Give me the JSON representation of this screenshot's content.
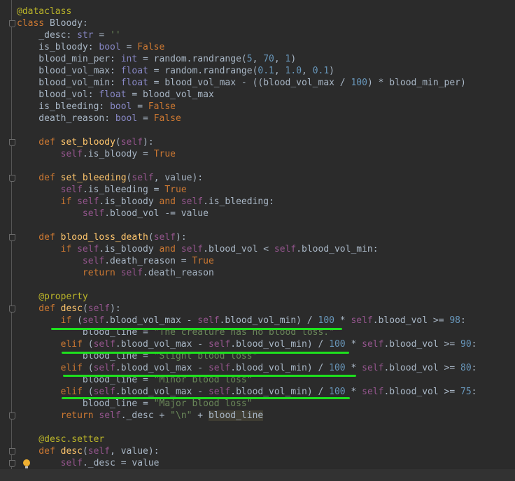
{
  "editor": {
    "lines": [
      [
        [
          "@dataclass",
          "dec"
        ]
      ],
      [
        [
          "class ",
          "kw"
        ],
        [
          "Bloody:",
          "plain"
        ]
      ],
      [
        [
          "    _desc: ",
          "plain"
        ],
        [
          "str",
          "bi"
        ],
        [
          " = ",
          "plain"
        ],
        [
          "''",
          "str"
        ]
      ],
      [
        [
          "    is_bloody: ",
          "plain"
        ],
        [
          "bool",
          "bi"
        ],
        [
          " = ",
          "plain"
        ],
        [
          "False",
          "kw"
        ]
      ],
      [
        [
          "    blood_min_per: ",
          "plain"
        ],
        [
          "int",
          "bi"
        ],
        [
          " = random.randrange(",
          "plain"
        ],
        [
          "5",
          "num"
        ],
        [
          ", ",
          "plain"
        ],
        [
          "70",
          "num"
        ],
        [
          ", ",
          "plain"
        ],
        [
          "1",
          "num"
        ],
        [
          ")",
          "plain"
        ]
      ],
      [
        [
          "    blood_vol_max: ",
          "plain"
        ],
        [
          "float",
          "bi"
        ],
        [
          " = random.randrange(",
          "plain"
        ],
        [
          "0.1",
          "num"
        ],
        [
          ", ",
          "plain"
        ],
        [
          "1.0",
          "num"
        ],
        [
          ", ",
          "plain"
        ],
        [
          "0.1",
          "num"
        ],
        [
          ")",
          "plain"
        ]
      ],
      [
        [
          "    blood_vol_min: ",
          "plain"
        ],
        [
          "float",
          "bi"
        ],
        [
          " = blood_vol_max - ((blood_vol_max / ",
          "plain"
        ],
        [
          "100",
          "num"
        ],
        [
          ") * blood_min_per)",
          "plain"
        ]
      ],
      [
        [
          "    blood_vol: ",
          "plain"
        ],
        [
          "float",
          "bi"
        ],
        [
          " = blood_vol_max",
          "plain"
        ]
      ],
      [
        [
          "    is_bleeding: ",
          "plain"
        ],
        [
          "bool",
          "bi"
        ],
        [
          " = ",
          "plain"
        ],
        [
          "False",
          "kw"
        ]
      ],
      [
        [
          "    death_reason: ",
          "plain"
        ],
        [
          "bool",
          "bi"
        ],
        [
          " = ",
          "plain"
        ],
        [
          "False",
          "kw"
        ]
      ],
      [],
      [
        [
          "    def ",
          "kw"
        ],
        [
          "set_bloody",
          "fn"
        ],
        [
          "(",
          "plain"
        ],
        [
          "self",
          "self"
        ],
        [
          "):",
          "plain"
        ]
      ],
      [
        [
          "        ",
          "plain"
        ],
        [
          "self",
          "self"
        ],
        [
          ".is_bloody = ",
          "plain"
        ],
        [
          "True",
          "kw"
        ]
      ],
      [],
      [
        [
          "    def ",
          "kw"
        ],
        [
          "set_bleeding",
          "fn"
        ],
        [
          "(",
          "plain"
        ],
        [
          "self",
          "self"
        ],
        [
          ", value):",
          "plain"
        ]
      ],
      [
        [
          "        ",
          "plain"
        ],
        [
          "self",
          "self"
        ],
        [
          ".is_bleeding = ",
          "plain"
        ],
        [
          "True",
          "kw"
        ]
      ],
      [
        [
          "        if ",
          "kw"
        ],
        [
          "self",
          "self"
        ],
        [
          ".is_bloody ",
          "plain"
        ],
        [
          "and ",
          "kw"
        ],
        [
          "self",
          "self"
        ],
        [
          ".is_bleeding:",
          "plain"
        ]
      ],
      [
        [
          "            ",
          "plain"
        ],
        [
          "self",
          "self"
        ],
        [
          ".blood_vol -= value",
          "plain"
        ]
      ],
      [],
      [
        [
          "    def ",
          "kw"
        ],
        [
          "blood_loss_death",
          "fn"
        ],
        [
          "(",
          "plain"
        ],
        [
          "self",
          "self"
        ],
        [
          "):",
          "plain"
        ]
      ],
      [
        [
          "        if ",
          "kw"
        ],
        [
          "self",
          "self"
        ],
        [
          ".is_bloody ",
          "plain"
        ],
        [
          "and ",
          "kw"
        ],
        [
          "self",
          "self"
        ],
        [
          ".blood_vol < ",
          "plain"
        ],
        [
          "self",
          "self"
        ],
        [
          ".blood_vol_min:",
          "plain"
        ]
      ],
      [
        [
          "            ",
          "plain"
        ],
        [
          "self",
          "self"
        ],
        [
          ".death_reason = ",
          "plain"
        ],
        [
          "True",
          "kw"
        ]
      ],
      [
        [
          "            return ",
          "kw"
        ],
        [
          "self",
          "self"
        ],
        [
          ".death_reason",
          "plain"
        ]
      ],
      [],
      [
        [
          "    @property",
          "dec"
        ]
      ],
      [
        [
          "    def ",
          "kw"
        ],
        [
          "desc",
          "fn"
        ],
        [
          "(",
          "plain"
        ],
        [
          "self",
          "self"
        ],
        [
          "):",
          "plain"
        ]
      ],
      [
        [
          "        if ",
          "kw"
        ],
        [
          "(",
          "plain"
        ],
        [
          "self",
          "self"
        ],
        [
          ".blood_vol_max - ",
          "plain"
        ],
        [
          "self",
          "self"
        ],
        [
          ".blood_vol_min) / ",
          "plain"
        ],
        [
          "100",
          "num"
        ],
        [
          " * ",
          "plain"
        ],
        [
          "self",
          "self"
        ],
        [
          ".blood_vol >= ",
          "plain"
        ],
        [
          "98",
          "num"
        ],
        [
          ":",
          "plain"
        ]
      ],
      [
        [
          "            blood_line = ",
          "plain"
        ],
        [
          "\"The creature has no blood loss.\"",
          "str"
        ]
      ],
      [
        [
          "        elif ",
          "kw"
        ],
        [
          "(",
          "plain"
        ],
        [
          "self",
          "self"
        ],
        [
          ".blood_vol_max - ",
          "plain"
        ],
        [
          "self",
          "self"
        ],
        [
          ".blood_vol_min) / ",
          "plain"
        ],
        [
          "100",
          "num"
        ],
        [
          " * ",
          "plain"
        ],
        [
          "self",
          "self"
        ],
        [
          ".blood_vol >= ",
          "plain"
        ],
        [
          "90",
          "num"
        ],
        [
          ":",
          "plain"
        ]
      ],
      [
        [
          "            blood_line = ",
          "plain"
        ],
        [
          "\"Slight blood loss\"",
          "str"
        ]
      ],
      [
        [
          "        elif ",
          "kw"
        ],
        [
          "(",
          "plain"
        ],
        [
          "self",
          "self"
        ],
        [
          ".blood_vol_max - ",
          "plain"
        ],
        [
          "self",
          "self"
        ],
        [
          ".blood_vol_min) / ",
          "plain"
        ],
        [
          "100",
          "num"
        ],
        [
          " * ",
          "plain"
        ],
        [
          "self",
          "self"
        ],
        [
          ".blood_vol >= ",
          "plain"
        ],
        [
          "80",
          "num"
        ],
        [
          ":",
          "plain"
        ]
      ],
      [
        [
          "            blood_line = ",
          "plain"
        ],
        [
          "\"Minor blood loss\"",
          "str"
        ]
      ],
      [
        [
          "        elif ",
          "kw"
        ],
        [
          "(",
          "plain"
        ],
        [
          "self",
          "self"
        ],
        [
          ".blood_vol_max - ",
          "plain"
        ],
        [
          "self",
          "self"
        ],
        [
          ".blood_vol_min) / ",
          "plain"
        ],
        [
          "100",
          "num"
        ],
        [
          " * ",
          "plain"
        ],
        [
          "self",
          "self"
        ],
        [
          ".blood_vol >= ",
          "plain"
        ],
        [
          "75",
          "num"
        ],
        [
          ":",
          "plain"
        ]
      ],
      [
        [
          "            blood_line = ",
          "plain"
        ],
        [
          "\"Major blood loss\"",
          "str"
        ]
      ],
      [
        [
          "        return ",
          "kw"
        ],
        [
          "self",
          "self"
        ],
        [
          "._desc + ",
          "plain"
        ],
        [
          "\"\\n\"",
          "str"
        ],
        [
          " + ",
          "plain"
        ],
        [
          "blood_line",
          "hl"
        ]
      ],
      [],
      [
        [
          "    @desc.setter",
          "dec"
        ]
      ],
      [
        [
          "    def ",
          "kw"
        ],
        [
          "desc",
          "fn"
        ],
        [
          "(",
          "plain"
        ],
        [
          "self",
          "self"
        ],
        [
          ", value):",
          "plain"
        ]
      ],
      [
        [
          "        ",
          "plain"
        ],
        [
          "self",
          "self"
        ],
        [
          "._desc = value",
          "plain"
        ]
      ],
      []
    ]
  },
  "colors": {
    "background": "#2b2b2b",
    "keyword": "#cc7832",
    "self": "#94558d",
    "number": "#6897bb",
    "string": "#6a8759",
    "decorator": "#bbb529",
    "function": "#ffc66d",
    "annotation_underline": "#1ee01e"
  }
}
